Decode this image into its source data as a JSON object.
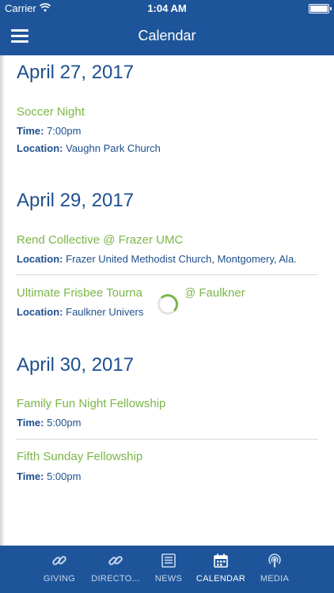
{
  "status_bar": {
    "carrier": "Carrier",
    "time": "1:04 AM"
  },
  "header": {
    "title": "Calendar"
  },
  "days": [
    {
      "date": "April 27, 2017",
      "events": [
        {
          "title": "Soccer Night",
          "time_label": "Time:",
          "time": "7:00pm",
          "location_label": "Location:",
          "location": "Vaughn Park Church"
        }
      ]
    },
    {
      "date": "April 29, 2017",
      "events": [
        {
          "title": "Rend Collective @ Frazer UMC",
          "location_label": "Location:",
          "location": "Frazer United Methodist Church, Montgomery, Ala."
        },
        {
          "title": "Ultimate Frisbee Tourna",
          "title_tail": "@ Faulkner",
          "location_label": "Location:",
          "location": "Faulkner Univers"
        }
      ]
    },
    {
      "date": "April 30, 2017",
      "events": [
        {
          "title": "Family Fun Night Fellowship",
          "time_label": "Time:",
          "time": "5:00pm"
        },
        {
          "title": "Fifth Sunday Fellowship",
          "time_label": "Time:",
          "time": "5:00pm"
        }
      ]
    }
  ],
  "tabs": [
    {
      "label": "GIVING",
      "icon": "link-icon",
      "active": false
    },
    {
      "label": "DIRECTO...",
      "icon": "link-icon",
      "active": false
    },
    {
      "label": "NEWS",
      "icon": "news-icon",
      "active": false
    },
    {
      "label": "CALENDAR",
      "icon": "calendar-icon",
      "active": true
    },
    {
      "label": "MEDIA",
      "icon": "podcast-icon",
      "active": false
    }
  ],
  "colors": {
    "brand": "#1e559a",
    "event_title": "#7ab648",
    "text": "#1e4f8f"
  }
}
